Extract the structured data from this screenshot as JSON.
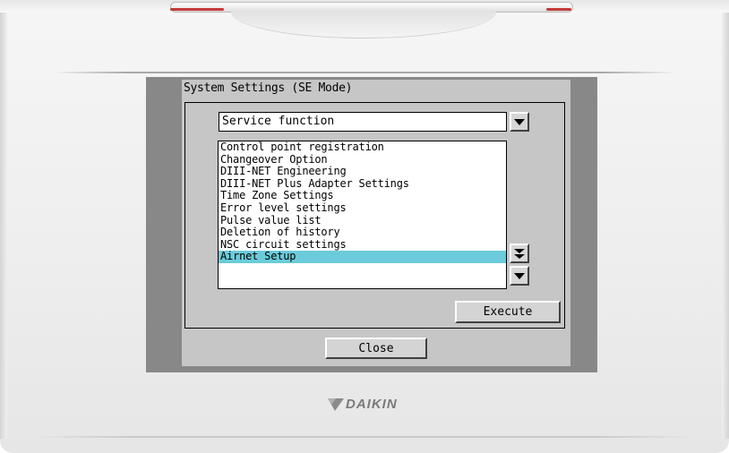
{
  "panel": {
    "title": "System Settings (SE Mode)"
  },
  "dropdown": {
    "selected": "Service function"
  },
  "list": {
    "items": [
      "Control point registration",
      "Changeover Option",
      "DIII-NET Engineering",
      "DIII-NET Plus Adapter Settings",
      "Time Zone Settings",
      "Error level settings",
      "Pulse value list",
      "Deletion of history",
      "NSC circuit settings",
      "Airnet Setup"
    ],
    "selected_index": 9
  },
  "buttons": {
    "execute": "Execute",
    "close": "Close"
  },
  "brand": {
    "name": "DAIKIN"
  },
  "colors": {
    "selection": "#6ccbda",
    "panel": "#c6c6c6",
    "bezel": "#888888"
  },
  "icons": {
    "dropdown_arrow": "chevron-down-icon",
    "page_down": "double-down-icon",
    "scroll_down": "chevron-down-icon"
  }
}
